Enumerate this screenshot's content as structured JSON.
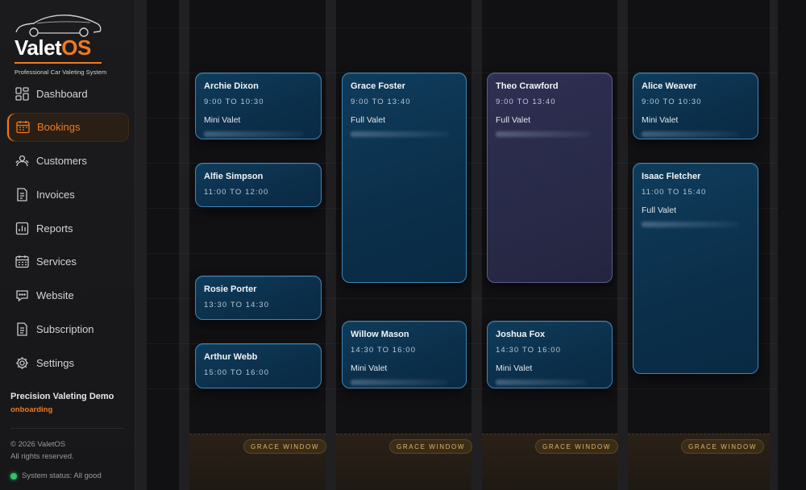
{
  "brand": {
    "name_main": "Valet",
    "name_accent": "OS",
    "tagline": "Professional Car Valeting System",
    "accent_color": "#f07a1e"
  },
  "nav": [
    {
      "label": "Dashboard",
      "icon": "dashboard-icon",
      "active": false
    },
    {
      "label": "Bookings",
      "icon": "calendar-icon",
      "active": true
    },
    {
      "label": "Customers",
      "icon": "customers-icon",
      "active": false
    },
    {
      "label": "Invoices",
      "icon": "invoice-icon",
      "active": false
    },
    {
      "label": "Reports",
      "icon": "reports-icon",
      "active": false
    },
    {
      "label": "Services",
      "icon": "services-icon",
      "active": false
    },
    {
      "label": "Website",
      "icon": "website-icon",
      "active": false
    },
    {
      "label": "Subscription",
      "icon": "subscription-icon",
      "active": false
    },
    {
      "label": "Settings",
      "icon": "gear-icon",
      "active": false
    }
  ],
  "tenant": {
    "name": "Precision Valeting Demo",
    "status": "onboarding"
  },
  "footer": {
    "copyright": "© 2026 ValetOS",
    "rights": "All rights reserved.",
    "system_status": "System status: All good",
    "status_color": "#33c46b"
  },
  "calendar": {
    "grace_label": "GRACE WINDOW",
    "columns": [
      {
        "bookings": [
          {
            "name": "Archie Dixon",
            "time": "9:00 TO 10:30",
            "service": "Mini Valet",
            "color": "blue"
          },
          {
            "name": "Alfie Simpson",
            "time": "11:00 TO 12:00",
            "service": "",
            "color": "blue"
          },
          {
            "name": "Rosie Porter",
            "time": "13:30 TO 14:30",
            "service": "",
            "color": "blue"
          },
          {
            "name": "Arthur Webb",
            "time": "15:00 TO 16:00",
            "service": "",
            "color": "blue"
          }
        ]
      },
      {
        "bookings": [
          {
            "name": "Grace Foster",
            "time": "9:00 TO 13:40",
            "service": "Full Valet",
            "color": "blue"
          },
          {
            "name": "Willow Mason",
            "time": "14:30 TO 16:00",
            "service": "Mini Valet",
            "color": "blue"
          }
        ]
      },
      {
        "bookings": [
          {
            "name": "Theo Crawford",
            "time": "9:00 TO 13:40",
            "service": "Full Valet",
            "color": "purple"
          },
          {
            "name": "Joshua Fox",
            "time": "14:30 TO 16:00",
            "service": "Mini Valet",
            "color": "blue"
          }
        ]
      },
      {
        "bookings": [
          {
            "name": "Alice Weaver",
            "time": "9:00 TO 10:30",
            "service": "Mini Valet",
            "color": "blue"
          },
          {
            "name": "Isaac Fletcher",
            "time": "11:00 TO 15:40",
            "service": "Full Valet",
            "color": "blue"
          }
        ]
      }
    ]
  }
}
